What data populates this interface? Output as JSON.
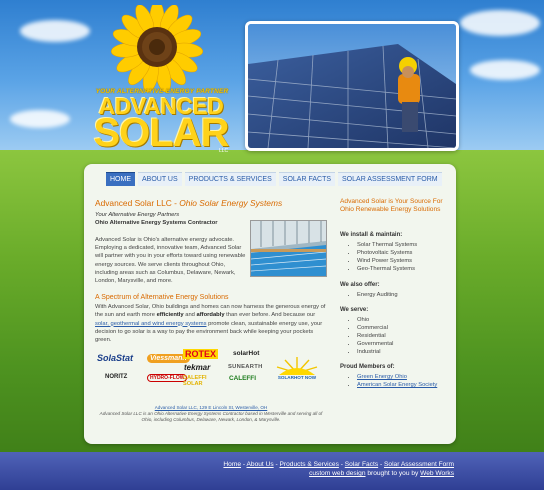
{
  "logo": {
    "tagline": "YOUR ALTERNATIVE ENERGY PARTNER",
    "line1": "ADVANCED",
    "line2": "SOLAR",
    "suffix": "LLC"
  },
  "nav": {
    "items": [
      {
        "label": "HOME",
        "active": true
      },
      {
        "label": "ABOUT US",
        "active": false
      },
      {
        "label": "PRODUCTS & SERVICES",
        "active": false
      },
      {
        "label": "SOLAR FACTS",
        "active": false
      },
      {
        "label": "SOLAR ASSESSMENT FORM",
        "active": false
      }
    ]
  },
  "main": {
    "heading": "Advanced Solar LLC - ",
    "heading_em": "Ohio Solar Energy Systems",
    "subtag": "Your Alternative Energy Partners",
    "subbold": "Ohio Alternative Energy Systems Contractor",
    "para1": "Advanced Solar is Ohio's alternative energy advocate. Employing a dedicated, innovative team, Advanced Solar will partner with you in your efforts toward using renewable energy sources. We serve clients throughout Ohio, including areas such as Columbus, Delaware, Newark, London, Marysville, and more.",
    "heading2": "A Spectrum of Alternative Energy Solutions",
    "para2_a": "With Advanced Solar, Ohio buildings and homes can now harness the generous energy of the sun and earth more ",
    "para2_b1": "efficiently",
    "para2_c": " and ",
    "para2_b2": "affordably",
    "para2_d": " than ever before. And because our ",
    "para2_link": "solar, geothermal and wind energy systems",
    "para2_e": " promote clean, sustainable energy use, your decision to go solar is a way to pay the environment back while keeping your pockets green.",
    "partner_logos": [
      "SolaStat",
      "Viessmann",
      "ROTEX",
      "solarHot",
      "tekmar",
      "SUNEARTH",
      "NORITZ",
      "HYDRO-FLOW",
      "CALEFFI SOLAR",
      "CALEFFI",
      "SOLARHOT NOW"
    ],
    "address": "Advanced Solar LLC, 129 E Lincoln St, Westerville, OH",
    "description": "Advanced Solar LLC is an Ohio Alternative Energy Systems Contractor based in Westerville and serving all of Ohio, including Columbus, Delaware, Newark, London, & Marysville."
  },
  "sidebar": {
    "title": "Advanced Solar is Your Source For Ohio Renewable Energy Solutions",
    "install_heading": "We install & maintain:",
    "install_items": [
      "Solar Thermal Systems",
      "Photovoltaic Systems",
      "Wind Power Systems",
      "Geo-Thermal Systems"
    ],
    "offer_heading": "We also offer:",
    "offer_items": [
      "Energy Auditing"
    ],
    "serve_heading": "We serve:",
    "serve_items": [
      "Ohio",
      "Commercial",
      "Residential",
      "Governmental",
      "Industrial"
    ],
    "members_heading": "Proud Members of:",
    "members_items": [
      "Green Energy Ohio",
      "American Solar Energy Society"
    ]
  },
  "footer": {
    "links": [
      "Home",
      "About Us",
      "Products & Services",
      "Solar Facts",
      "Solar Assessment Form"
    ],
    "separator": " - ",
    "credit_link": "custom web design",
    "credit_text": " brought to you by ",
    "credit_company": "Web Works"
  },
  "colors": {
    "accent": "#d96a00",
    "link": "#2a5ca8",
    "nav_active": "#3a6fc0",
    "footer": "#3a4ba4"
  }
}
